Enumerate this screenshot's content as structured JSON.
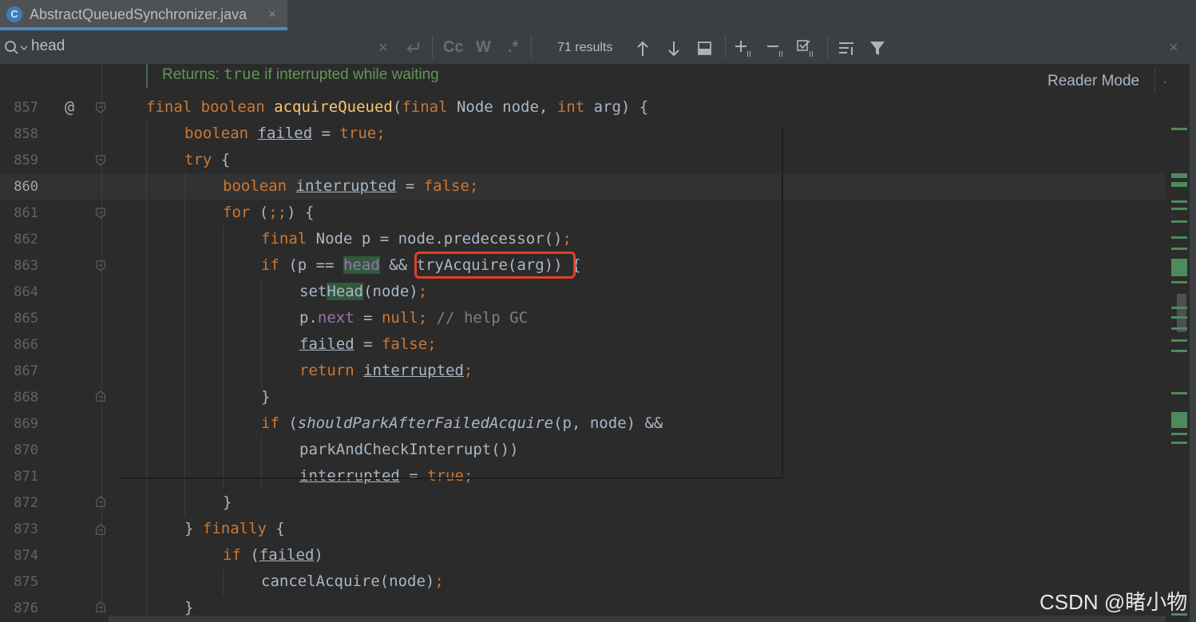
{
  "tab": {
    "icon_letter": "C",
    "title": "AbstractQueuedSynchronizer.java",
    "close": "×"
  },
  "search": {
    "query": "head",
    "results": "71 results",
    "clear": "×",
    "regex_icons": [
      "Cc",
      "W",
      ".*"
    ]
  },
  "doc_comment": {
    "prefix": "Returns: ",
    "code": "true",
    "text": " if interrupted while waiting"
  },
  "reader_mode": "Reader Mode",
  "line_numbers": [
    "857",
    "858",
    "859",
    "860",
    "861",
    "862",
    "863",
    "864",
    "865",
    "866",
    "867",
    "868",
    "869",
    "870",
    "871",
    "872",
    "873",
    "874",
    "875",
    "876"
  ],
  "current_line": "860",
  "annotation_marker": "@",
  "watermark": "CSDN @睹小物",
  "colors": {
    "background": "#2b2b2b",
    "keyword": "#cc7832",
    "method": "#ffc66d",
    "field": "#9876aa",
    "comment": "#808080",
    "search_highlight": "#32593d",
    "annotation_box": "#e0402a",
    "doc_comment": "#629755"
  },
  "code": {
    "l857": {
      "a": "final boolean ",
      "b": "acquireQueued",
      "c": "(",
      "d": "final ",
      "e": "Node node, ",
      "f": "int ",
      "g": "arg) {"
    },
    "l858": {
      "a": "boolean ",
      "b": "failed",
      "c": " = ",
      "d": "true",
      ";": ";"
    },
    "l859": {
      "a": "try ",
      "b": "{"
    },
    "l860": {
      "a": "boolean ",
      "b": "interrupted",
      "c": " = ",
      "d": "false",
      ";": ";"
    },
    "l861": {
      "a": "for ",
      "b": "(",
      "c": ";;",
      "d": ") {"
    },
    "l862": {
      "a": "final ",
      "b": "Node p = node.predecessor()",
      "c": ";"
    },
    "l863": {
      "a": "if ",
      "b": "(p == ",
      "c": "head",
      "d": " && ",
      "e": "tryAcquire(arg))",
      "f": " {"
    },
    "l864": {
      "a": "set",
      "b": "Head",
      "c": "(node)",
      "d": ";"
    },
    "l865": {
      "a": "p.",
      "b": "next",
      "c": " = ",
      "d": "null",
      "e": "; ",
      "f": "// help GC"
    },
    "l866": {
      "a": "failed",
      "b": " = ",
      "c": "false",
      "d": ";"
    },
    "l867": {
      "a": "return ",
      "b": "interrupted",
      "c": ";"
    },
    "l868": {
      "a": "}"
    },
    "l869": {
      "a": "if ",
      "b": "(",
      "c": "shouldParkAfterFailedAcquire",
      "d": "(p, node) &&"
    },
    "l870": {
      "a": "parkAndCheckInterrupt())"
    },
    "l871": {
      "a": "interrupted",
      "b": " = ",
      "c": "true",
      "d": ";"
    },
    "l872": {
      "a": "}"
    },
    "l873": {
      "a": "} ",
      "b": "finally ",
      "c": "{"
    },
    "l874": {
      "a": "if ",
      "b": "(",
      "c": "failed",
      "d": ")"
    },
    "l875": {
      "a": "cancelAcquire(node)",
      "b": ";"
    },
    "l876": {
      "a": "}"
    }
  }
}
